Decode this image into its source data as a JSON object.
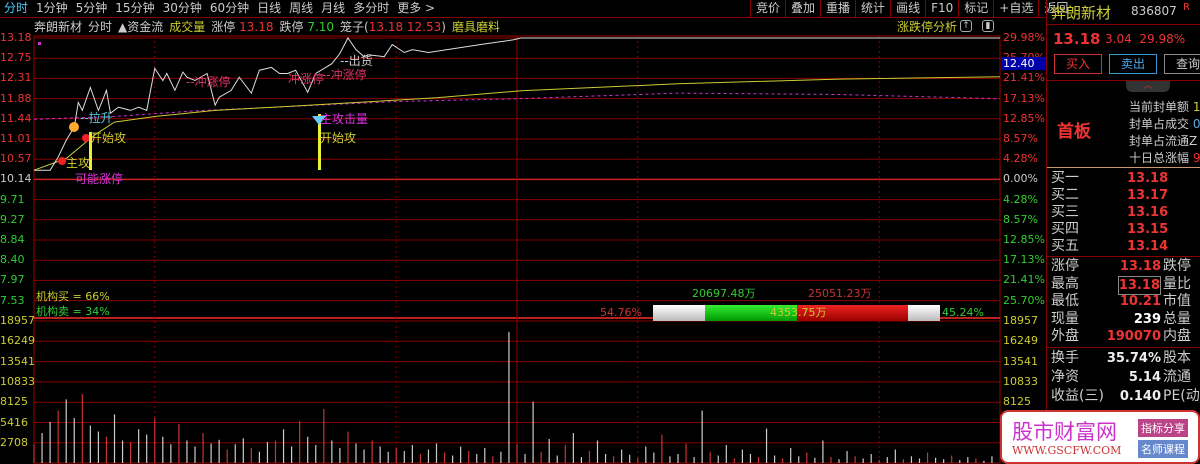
{
  "tabs": [
    "分时",
    "1分钟",
    "5分钟",
    "15分钟",
    "30分钟",
    "60分钟",
    "日线",
    "周线",
    "月线",
    "多分时",
    "更多 >"
  ],
  "toolbar": [
    "竞价",
    "叠加",
    "重播",
    "统计",
    "画线",
    "F10",
    "标记",
    "+自选",
    "返回"
  ],
  "info": {
    "name": "奔朗新材",
    "mode": "分时",
    "fund": "▲资金流",
    "vol": "成交量",
    "zt_label": "涨停",
    "zt": "13.18",
    "dt_label": "跌停",
    "dt": "7.10",
    "cage_label": "笼子(",
    "cage": "13.18 12.53",
    "cage_end": ")",
    "tool": "磨具磨料",
    "analysis": "涨跌停分析",
    "cursor_price": "12.40"
  },
  "axes": {
    "left_price": [
      "13.18",
      "12.75",
      "12.31",
      "11.88",
      "11.44",
      "11.01",
      "10.57",
      "10.14",
      "9.71",
      "9.27",
      "8.84",
      "8.40",
      "7.97",
      "7.53"
    ],
    "right_pct": [
      "29.98%",
      "25.70%",
      "21.41%",
      "17.13%",
      "12.85%",
      "8.57%",
      "4.28%",
      "0.00%",
      "4.28%",
      "8.57%",
      "12.85%",
      "17.13%",
      "21.41%",
      "25.70%"
    ],
    "vol": [
      "18957",
      "16249",
      "13541",
      "10833",
      "8125",
      "5416",
      "2708"
    ]
  },
  "annotations": {
    "lasheng": "--拉升",
    "kaishigong1": "开始攻",
    "zhugong": "主攻",
    "keneng": "可能涨停",
    "chongzt1": "--冲涨停",
    "chongzt2": "冲涨停",
    "chongzt3": "--冲涨停",
    "chuhuo": "--出货",
    "gongjiliang": "主攻击量",
    "kaishigong2": "开始攻"
  },
  "inst": {
    "buy": "机构买 = 66%",
    "sell": "机构卖 = 34%",
    "left_pct": "54.76%",
    "right_pct": "45.24%",
    "buy_amt": "20697.48万",
    "sell_amt": "25051.23万",
    "net": "4353.75万",
    "buy_frac": 0.4524,
    "sell_frac": 0.5476
  },
  "chart_data": {
    "type": "line",
    "prev_close": 10.14,
    "ylim": [
      7.53,
      13.18
    ],
    "minutes": 240,
    "price": [
      [
        0,
        10.35
      ],
      [
        4,
        10.35
      ],
      [
        6,
        10.63
      ],
      [
        8,
        10.99
      ],
      [
        10,
        11.27
      ],
      [
        11,
        11.8
      ],
      [
        12,
        11.63
      ],
      [
        14,
        12.12
      ],
      [
        16,
        11.63
      ],
      [
        17,
        11.84
      ],
      [
        18,
        12.06
      ],
      [
        19,
        11.57
      ],
      [
        21,
        11.7
      ],
      [
        24,
        11.63
      ],
      [
        26,
        11.7
      ],
      [
        28,
        11.63
      ],
      [
        30,
        12.53
      ],
      [
        32,
        12.27
      ],
      [
        33,
        12.42
      ],
      [
        35,
        12.06
      ],
      [
        37,
        12.45
      ],
      [
        38,
        12.34
      ],
      [
        40,
        12.27
      ],
      [
        43,
        12.42
      ],
      [
        45,
        11.74
      ],
      [
        46,
        11.91
      ],
      [
        49,
        12.06
      ],
      [
        51,
        12.34
      ],
      [
        54,
        12.0
      ],
      [
        56,
        12.49
      ],
      [
        59,
        12.55
      ],
      [
        61,
        12.42
      ],
      [
        63,
        12.42
      ],
      [
        65,
        12.49
      ],
      [
        68,
        12.02
      ],
      [
        70,
        12.42
      ],
      [
        74,
        12.63
      ],
      [
        76,
        12.85
      ],
      [
        78,
        13.18
      ],
      [
        80,
        12.93
      ],
      [
        82,
        12.78
      ],
      [
        83,
        12.82
      ],
      [
        87,
        12.78
      ],
      [
        89,
        13.04
      ],
      [
        92,
        12.87
      ],
      [
        94,
        12.93
      ],
      [
        98,
        12.87
      ],
      [
        111,
        13.04
      ],
      [
        119,
        13.14
      ],
      [
        121,
        13.18
      ],
      [
        240,
        13.18
      ]
    ],
    "avg": [
      [
        0,
        10.35
      ],
      [
        8,
        10.6
      ],
      [
        15,
        11.1
      ],
      [
        20,
        11.38
      ],
      [
        30,
        11.5
      ],
      [
        45,
        11.63
      ],
      [
        60,
        11.7
      ],
      [
        80,
        11.8
      ],
      [
        100,
        11.9
      ],
      [
        121,
        12.05
      ],
      [
        160,
        12.2
      ],
      [
        200,
        12.3
      ],
      [
        240,
        12.35
      ]
    ],
    "ref": [
      [
        0,
        11.44
      ],
      [
        20,
        11.5
      ],
      [
        40,
        11.62
      ],
      [
        60,
        11.7
      ],
      [
        90,
        11.82
      ],
      [
        120,
        11.88
      ],
      [
        160,
        12.0
      ],
      [
        200,
        11.97
      ],
      [
        240,
        11.88
      ]
    ],
    "volume": [
      2500,
      4000,
      5500,
      7000,
      8500,
      6000,
      9200,
      5000,
      4200,
      3500,
      6500,
      3000,
      2800,
      4500,
      3800,
      6000,
      3500,
      2500,
      5200,
      3000,
      2200,
      4000,
      2600,
      3100,
      1800,
      2500,
      3300,
      2000,
      1500,
      2800,
      3000,
      4500,
      2200,
      5600,
      3500,
      2400,
      7200,
      3000,
      2000,
      4200,
      2600,
      1800,
      3000,
      2200,
      1500,
      2000,
      1600,
      2400,
      1200,
      1800,
      2600,
      1400,
      1000,
      2200,
      1600,
      1200,
      2000,
      900,
      1500,
      17500,
      2500,
      1200,
      8200,
      1500,
      3200,
      1000,
      2400,
      4000,
      800,
      1600,
      3000,
      1200,
      900,
      1800,
      1100,
      700,
      2200,
      1400,
      3800,
      900,
      1200,
      2600,
      800,
      7000,
      1500,
      1000,
      2400,
      600,
      1800,
      1200,
      800,
      4600,
      1000,
      600,
      2000,
      900,
      1400,
      700,
      3000,
      800,
      500,
      1600,
      900,
      600,
      1200,
      400,
      800,
      1800,
      500,
      900,
      600,
      1400,
      700,
      500,
      1000,
      400,
      800,
      600,
      300,
      900
    ],
    "vol_max": 18957
  },
  "panel": {
    "name": "奔朗新材",
    "code": "836807",
    "r": "R",
    "price": "13.18",
    "chg": "3.04",
    "pct": "29.98%",
    "buy": "买入",
    "sell": "卖出",
    "query": "查询",
    "board": "首板",
    "seal": [
      "当前封单额",
      "封单占成交",
      "封单占流通Z",
      "十日总涨幅"
    ],
    "seal_vals": [
      "1",
      "0.",
      "",
      "9"
    ],
    "bids": [
      {
        "k": "买一",
        "v": "13.18"
      },
      {
        "k": "买二",
        "v": "13.17"
      },
      {
        "k": "买三",
        "v": "13.16"
      },
      {
        "k": "买四",
        "v": "13.15"
      },
      {
        "k": "买五",
        "v": "13.14"
      }
    ],
    "stats": [
      {
        "k": "涨停",
        "v": "13.18",
        "k2": "跌停"
      },
      {
        "k": "最高",
        "v": "13.18",
        "k2": "量比"
      },
      {
        "k": "最低",
        "v": "10.21",
        "k2": "市值"
      },
      {
        "k": "现量",
        "v": "239",
        "k2": "总量"
      },
      {
        "k": "外盘",
        "v": "190070",
        "k2": "内盘"
      }
    ],
    "fin": [
      {
        "k": "换手",
        "v": "35.74%",
        "k2": "股本"
      },
      {
        "k": "净资",
        "v": "5.14",
        "k2": "流通"
      },
      {
        "k": "收益(三)",
        "v": "0.140",
        "k2": "PE(动"
      }
    ]
  },
  "watermark": {
    "site": "股市财富网",
    "url": "WWW.GSCFW.COM",
    "tag1": "指标分享",
    "tag2": "名师课程"
  }
}
